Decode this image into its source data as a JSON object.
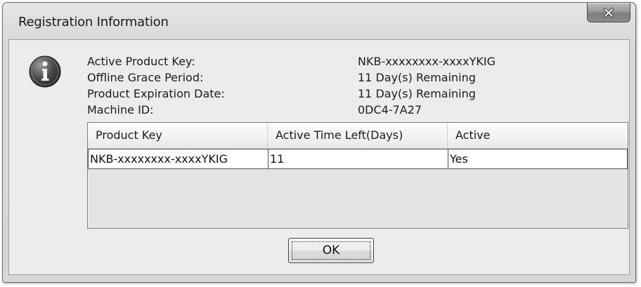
{
  "window": {
    "title": "Registration Information"
  },
  "icons": {
    "close": "close-icon",
    "info": "info-icon"
  },
  "info": {
    "rows": [
      {
        "label": "Active Product Key:",
        "value": "NKB-xxxxxxxx-xxxxYKIG"
      },
      {
        "label": "Offline Grace Period:",
        "value": "11 Day(s) Remaining"
      },
      {
        "label": "Product Expiration Date:",
        "value": "11 Day(s) Remaining"
      },
      {
        "label": "Machine ID:",
        "value": "0DC4-7A27"
      }
    ]
  },
  "table": {
    "columns": [
      "Product Key",
      "Active Time Left(Days)",
      "Active"
    ],
    "rows": [
      [
        "NKB-xxxxxxxx-xxxxYKIG",
        "11",
        "Yes"
      ]
    ]
  },
  "buttons": {
    "ok_label": "OK"
  }
}
